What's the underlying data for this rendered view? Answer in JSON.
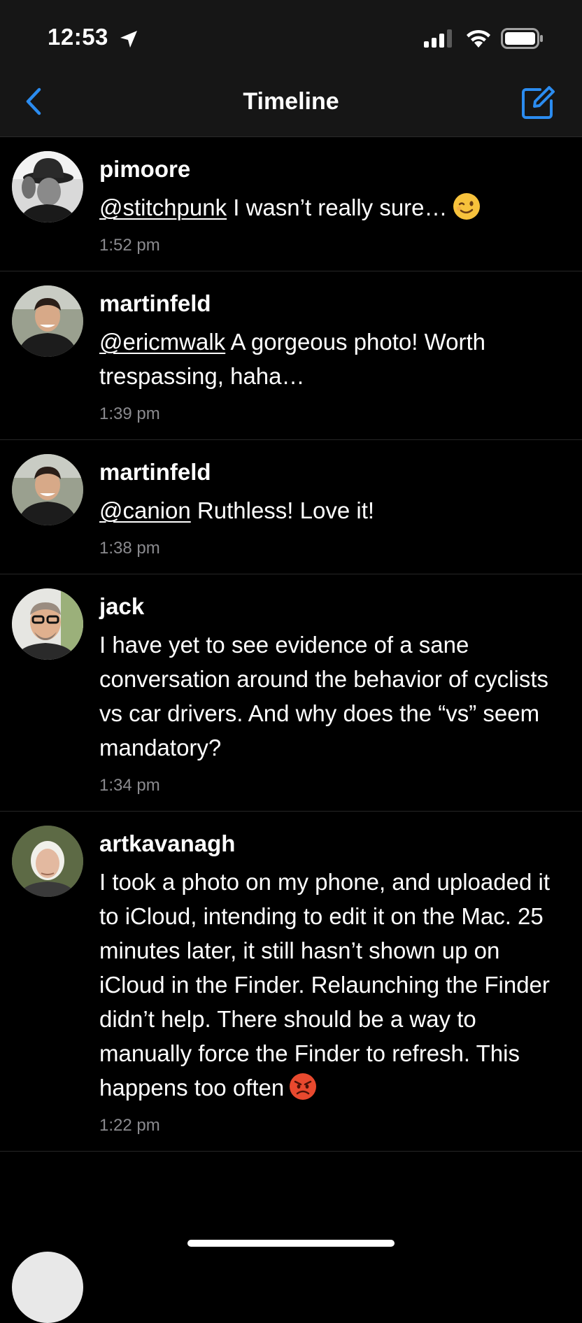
{
  "status_bar": {
    "time": "12:53"
  },
  "nav": {
    "title": "Timeline"
  },
  "colors": {
    "accent": "#2b8cf0",
    "background": "#000000",
    "bar_background": "#161616",
    "timestamp": "#8a8a8e"
  },
  "posts": [
    {
      "username": "pimoore",
      "mention": "@stitchpunk",
      "text": " I wasn’t really sure…",
      "emoji": "winking-face",
      "time": "1:52 pm"
    },
    {
      "username": "martinfeld",
      "mention": "@ericmwalk",
      "text": " A gorgeous photo! Worth trespassing, haha…",
      "time": "1:39 pm"
    },
    {
      "username": "martinfeld",
      "mention": "@canion",
      "text": " Ruthless! Love it!",
      "time": "1:38 pm"
    },
    {
      "username": "jack",
      "text": "I have yet to see evidence of a sane conversation around the behavior of cyclists vs car drivers. And why does the “vs” seem mandatory?",
      "time": "1:34 pm"
    },
    {
      "username": "artkavanagh",
      "text": "I took a photo on my phone, and uploaded it to iCloud, intending to edit it on the Mac. 25 minutes later, it still hasn’t shown up on iCloud in the Finder. Relaunching the Finder didn’t help. There should be a way to manually force the Finder to refresh. This happens too often",
      "emoji": "angry-face",
      "time": "1:22 pm"
    }
  ]
}
